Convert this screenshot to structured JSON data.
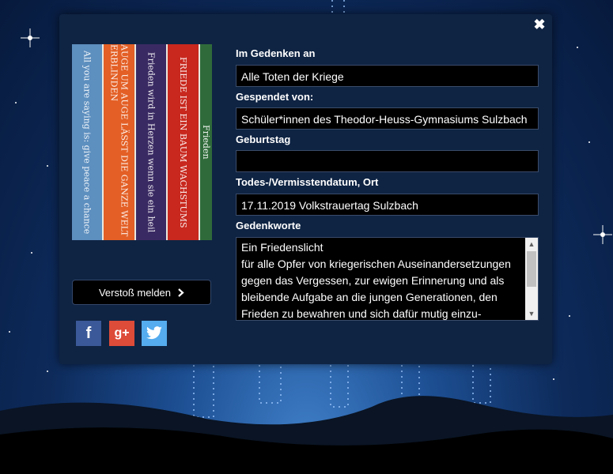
{
  "dialog": {
    "close_label": "✖",
    "fields": {
      "in_memory_label": "Im Gedenken an",
      "in_memory_value": "Alle Toten  der Kriege",
      "donated_by_label": "Gespendet von:",
      "donated_by_value": "Schüler*innen des Theodor-Heuss-Gymnasiums Sulzbach",
      "birthday_label": "Geburtstag",
      "birthday_value": "",
      "death_label": "Todes-/Vermisstendatum, Ort",
      "death_value": "17.11.2019 Volkstrauertag Sulzbach",
      "words_label": "Gedenkworte",
      "words_lines": [
        "Ein Friedenslicht",
        "für alle Opfer von kriegerischen Auseinandersetzungen",
        "gegen das Vergessen, zur ewigen Erinnerung und als",
        "bleibende Aufgabe an die jungen Generationen, den",
        "Frieden zu bewahren und sich dafür mutig einzu-"
      ]
    },
    "report_button": "Verstoß melden",
    "photo_texts": [
      "All you are saying is: give peace a chance",
      "AUGE UM AUGE LÄSST DIE GANZE WELT ERBLINDEN",
      "Frieden wird in Herzen wenn sie ein heil",
      "FRIEDE IST EIN BAUM WACHSTUMS",
      "Frieden"
    ],
    "social": {
      "facebook_glyph": "f",
      "googleplus_glyph": "g+",
      "twitter_icon": "twitter-bird-icon"
    }
  },
  "colors": {
    "modal_bg": "#0f2443",
    "facebook": "#3b5998",
    "googleplus": "#dd4b39",
    "twitter": "#55acee"
  }
}
